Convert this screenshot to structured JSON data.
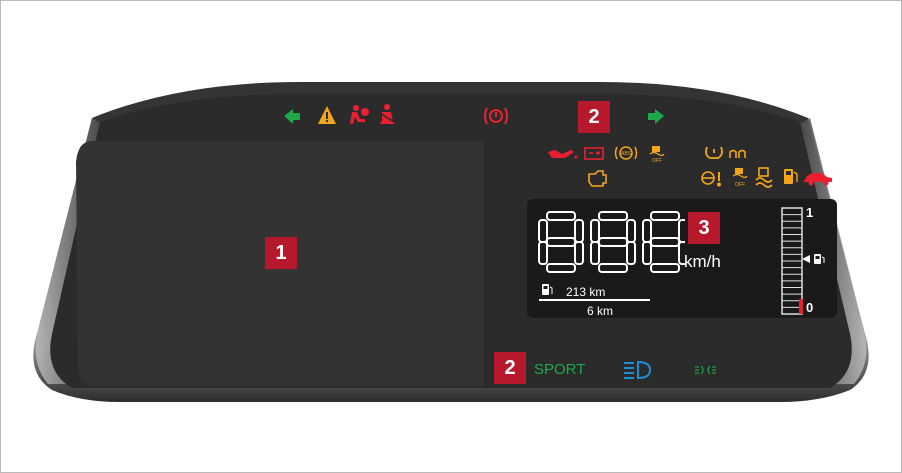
{
  "callouts": {
    "info_area": "1",
    "warning_top": "2",
    "speedometer": "3",
    "indicator_bottom": "2"
  },
  "speedometer": {
    "digits": "888",
    "unit": "km/h"
  },
  "trip": {
    "range": "213 km",
    "trip_distance": "6 km"
  },
  "fuel_gauge": {
    "full_label": "1",
    "empty_label": "0",
    "level": 0.5
  },
  "drive_mode": {
    "label": "SPORT"
  },
  "icons": {
    "top_row": [
      "turn-left-icon",
      "hazard-warning-icon",
      "airbag-icon",
      "seatbelt-icon",
      "parking-brake-icon",
      "turn-right-icon"
    ],
    "amber_row1": [
      "oil-pressure-icon",
      "battery-icon",
      "abs-icon",
      "traction-off-icon",
      "tire-pressure-icon",
      "glow-plug-icon"
    ],
    "amber_row2": [
      "check-engine-icon",
      "power-steering-icon",
      "esp-off-icon",
      "stability-control-icon",
      "low-fuel-icon",
      "door-open-icon"
    ],
    "bottom_row": [
      "high-beam-icon",
      "parking-lights-icon"
    ]
  },
  "colors": {
    "red": "#e8202f",
    "amber": "#f3a51c",
    "green": "#1ea84a",
    "blue": "#1a8fd6",
    "panel": "#2b2b2b",
    "callout": "#b5192b"
  }
}
